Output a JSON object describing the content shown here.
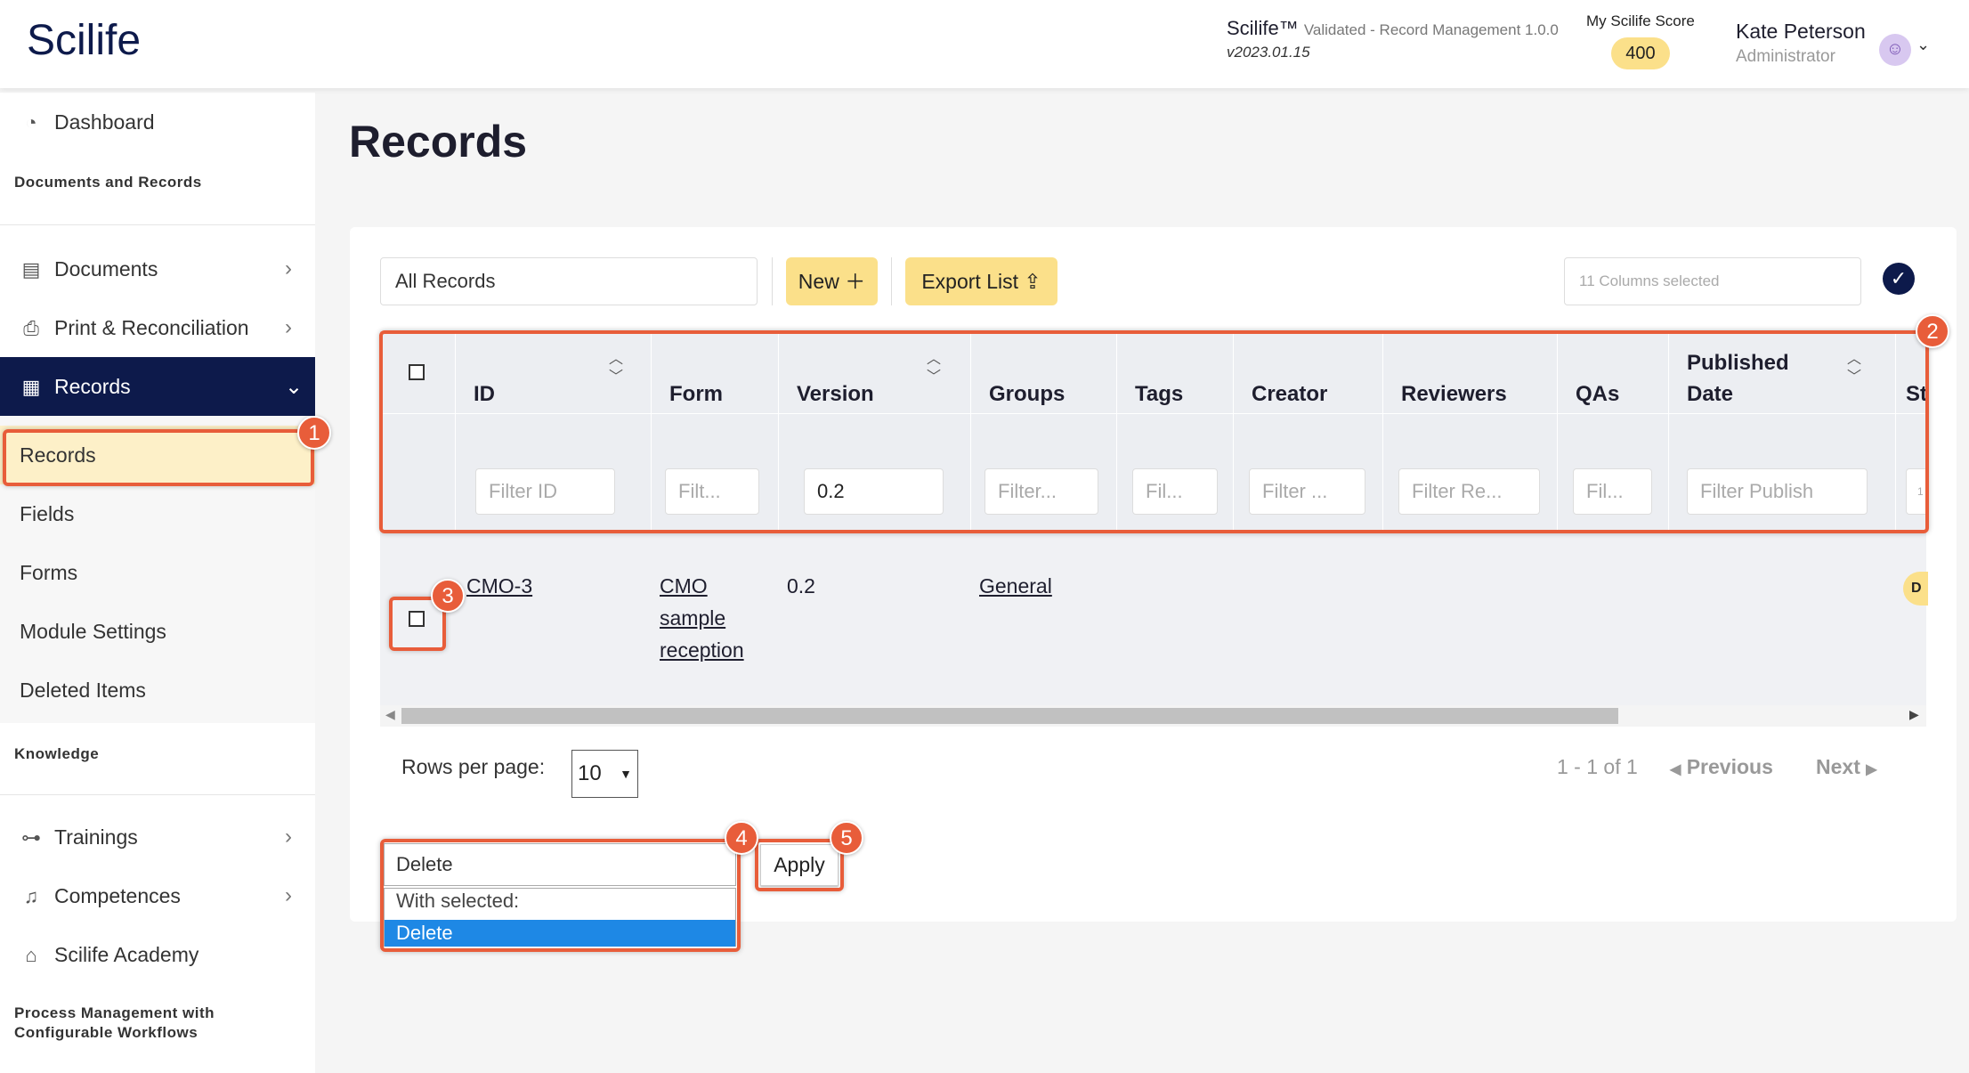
{
  "header": {
    "logo": "Scilife",
    "app_name": "Scilife™",
    "app_sub": "Validated - Record Management 1.0.0",
    "app_version": "v2023.01.15",
    "score_label": "My Scilife Score",
    "score_value": "400",
    "user_name": "Kate Peterson",
    "user_role": "Administrator"
  },
  "sidebar": {
    "dashboard": "Dashboard",
    "section_docs": "Documents and Records",
    "documents": "Documents",
    "print": "Print & Reconciliation",
    "records": "Records",
    "sub": [
      "Records",
      "Fields",
      "Forms",
      "Module Settings",
      "Deleted Items"
    ],
    "section_knowledge": "Knowledge",
    "trainings": "Trainings",
    "competences": "Competences",
    "academy": "Scilife Academy",
    "section_process": "Process Management with Configurable Workflows"
  },
  "page": {
    "title": "Records",
    "view_select": "All Records",
    "new_label": "New",
    "export_label": "Export List",
    "columns_placeholder": "11 Columns selected"
  },
  "table": {
    "columns": [
      {
        "label": "ID",
        "filter": "Filter ID"
      },
      {
        "label": "Form",
        "filter": "Filt..."
      },
      {
        "label": "Version",
        "filter": "0.2"
      },
      {
        "label": "Groups",
        "filter": "Filter..."
      },
      {
        "label": "Tags",
        "filter": "Fil..."
      },
      {
        "label": "Creator",
        "filter": "Filter ..."
      },
      {
        "label": "Reviewers",
        "filter": "Filter Re..."
      },
      {
        "label": "QAs",
        "filter": "Fil..."
      },
      {
        "label": "Published Date",
        "filter": "Filter Publish"
      },
      {
        "label": "St",
        "filter": "1"
      }
    ],
    "rows": [
      {
        "id": "CMO-3",
        "form": "CMO sample reception",
        "version": "0.2",
        "groups": "General",
        "status": "D"
      }
    ]
  },
  "pagination": {
    "rows_label": "Rows per page:",
    "rows_value": "10",
    "range": "1 - 1 of 1",
    "previous": "Previous",
    "next": "Next"
  },
  "bulk": {
    "selected": "Delete",
    "options_header": "With selected:",
    "option_delete": "Delete",
    "apply": "Apply"
  },
  "annotations": [
    "1",
    "2",
    "3",
    "4",
    "5"
  ],
  "colors": {
    "accent": "#e85d3a",
    "navy": "#0d1a4b",
    "yellow": "#fbe08a"
  }
}
